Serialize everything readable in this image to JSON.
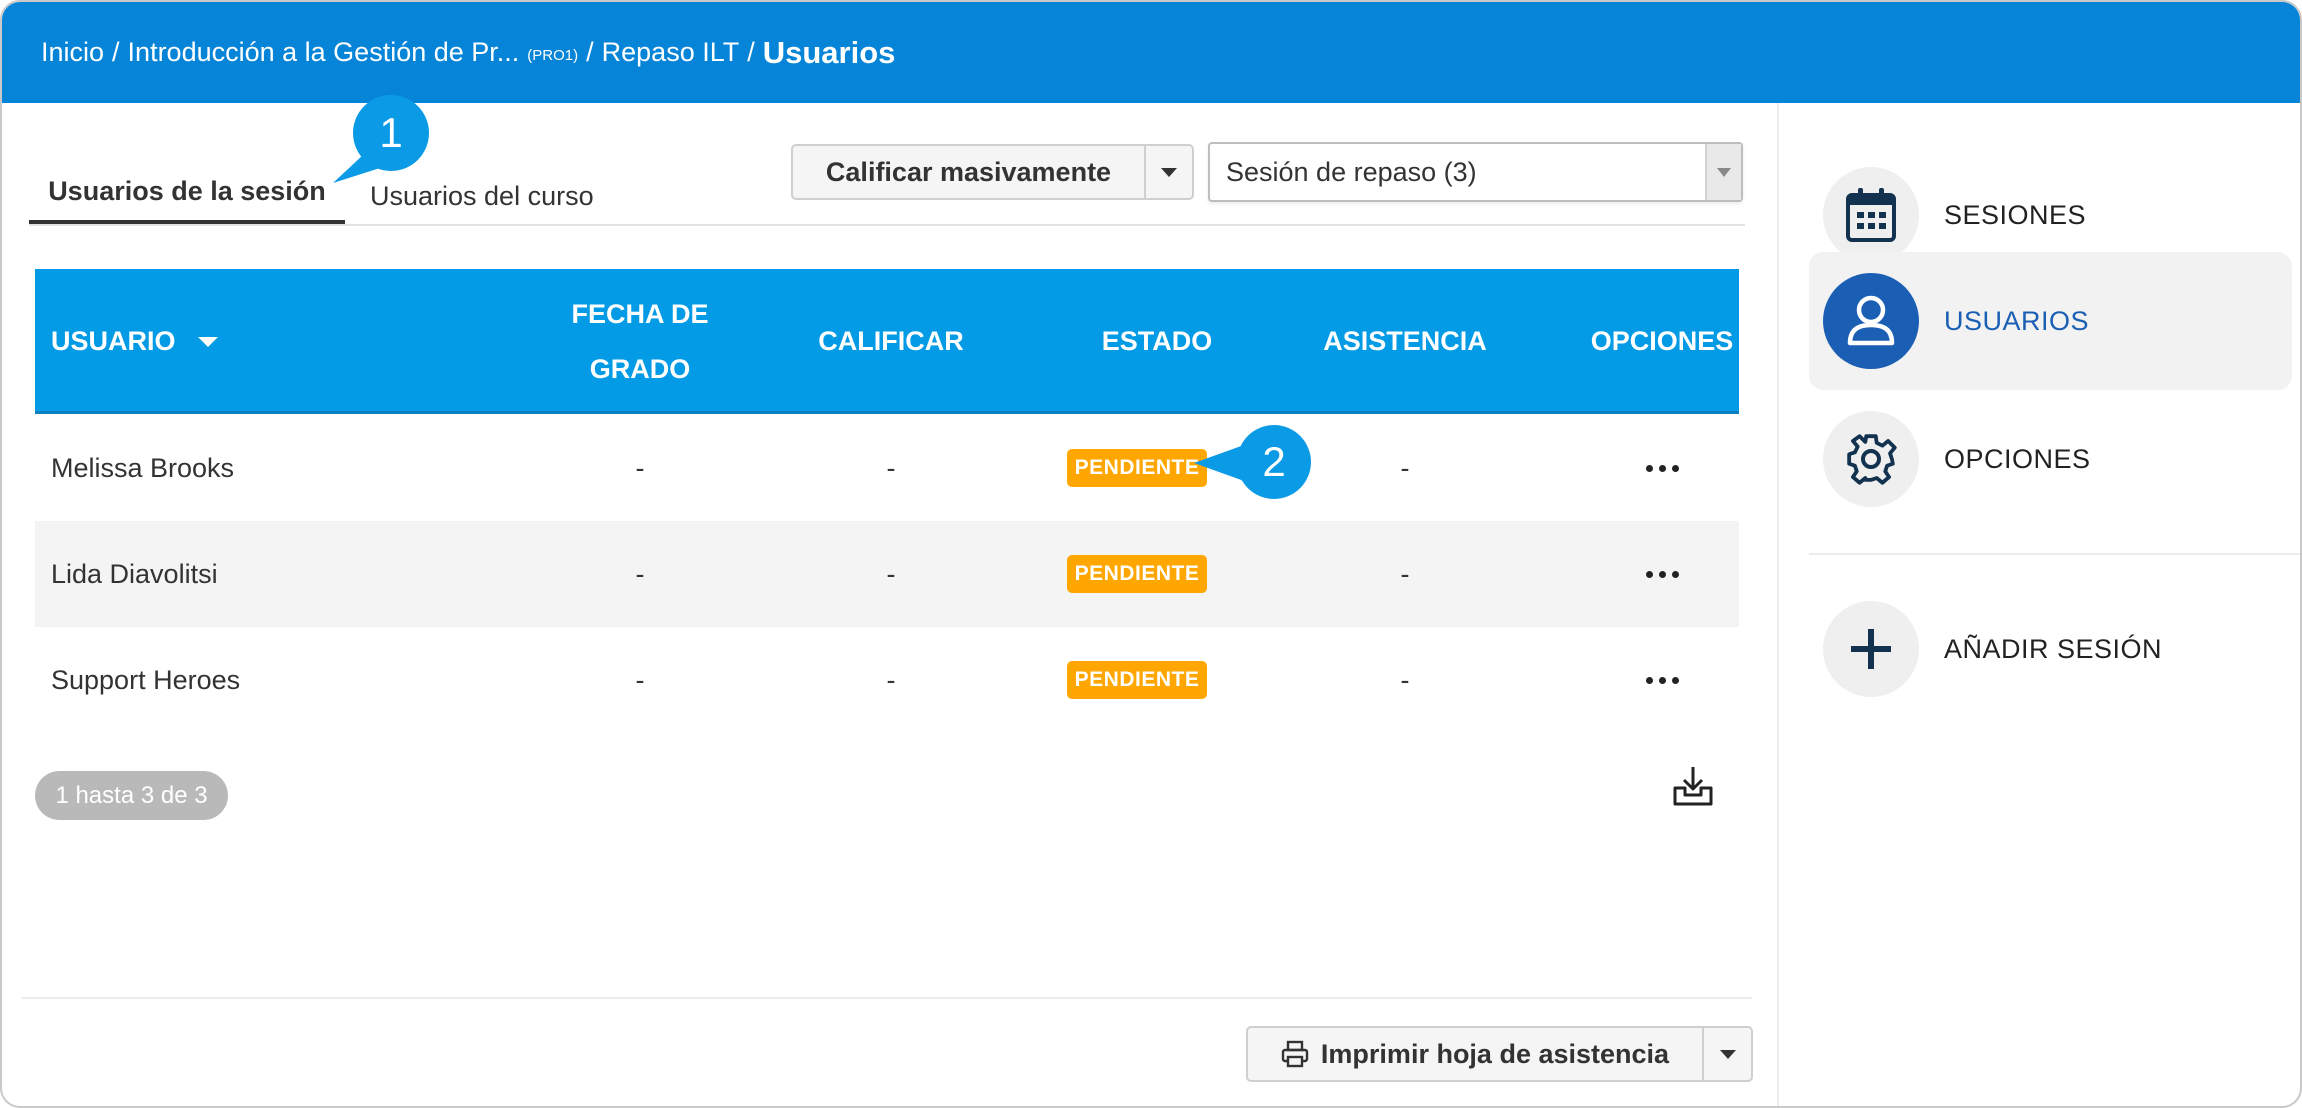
{
  "breadcrumb": {
    "items": [
      "Inicio",
      "Introducción a la Gestión de Pr...",
      "Repaso ILT"
    ],
    "course_code": "(PRO1)",
    "current": "Usuarios",
    "separator": "/"
  },
  "tabs": {
    "session_users": "Usuarios de la sesión",
    "course_users": "Usuarios del curso"
  },
  "controls": {
    "mass_grade_label": "Calificar masivamente",
    "session_select_value": "Sesión de repaso (3)"
  },
  "table": {
    "headers": {
      "user": "USUARIO",
      "grade_date_line1": "FECHA DE",
      "grade_date_line2": "GRADO",
      "grade": "CALIFICAR",
      "status": "ESTADO",
      "attendance": "ASISTENCIA",
      "options": "OPCIONES"
    },
    "rows": [
      {
        "user": "Melissa Brooks",
        "grade_date": "-",
        "grade": "-",
        "status": "PENDIENTE",
        "attendance": "-"
      },
      {
        "user": "Lida Diavolitsi",
        "grade_date": "-",
        "grade": "-",
        "status": "PENDIENTE",
        "attendance": "-"
      },
      {
        "user": "Support Heroes",
        "grade_date": "-",
        "grade": "-",
        "status": "PENDIENTE",
        "attendance": "-"
      }
    ]
  },
  "pager": {
    "label": "1 hasta 3 de 3"
  },
  "footer": {
    "print_label": "Imprimir hoja de asistencia"
  },
  "sidebar": {
    "items": [
      {
        "label": "SESIONES",
        "icon": "calendar-icon"
      },
      {
        "label": "USUARIOS",
        "icon": "user-icon"
      },
      {
        "label": "OPCIONES",
        "icon": "gear-icon"
      },
      {
        "label": "AÑADIR SESIÓN",
        "icon": "plus-icon"
      }
    ]
  },
  "callouts": {
    "first": "1",
    "second": "2"
  },
  "colors": {
    "header_blue": "#0685d8",
    "table_header_blue": "#039be5",
    "badge_orange": "#ffa600",
    "active_blue": "#1a5fb4",
    "callout_blue": "#0b9ae6"
  }
}
